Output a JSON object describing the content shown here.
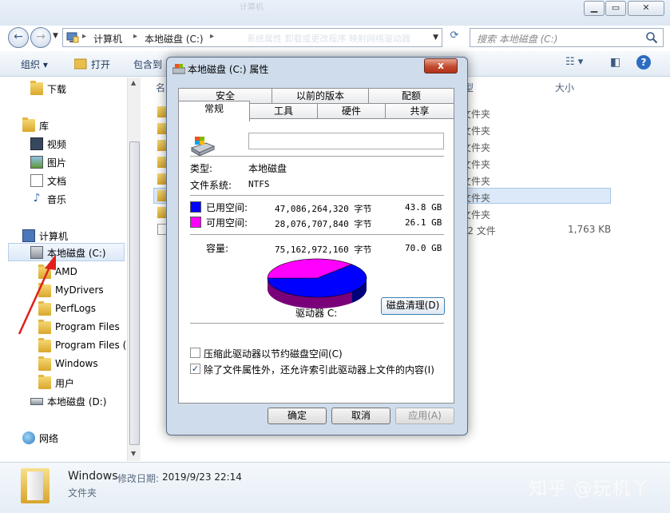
{
  "explorer": {
    "faint_title": "计算机",
    "address": {
      "segments": [
        "计算机",
        "本地磁盘 (C:)"
      ],
      "faint_text": "系统属性    卸载或更改程序    映射网络驱动器"
    },
    "search_placeholder": "搜索 本地磁盘 (C:)",
    "toolbar": {
      "organize": "组织",
      "open": "打开",
      "include": "包含到"
    },
    "nav": {
      "downloads": "下载",
      "library": "库",
      "videos": "视频",
      "pictures": "图片",
      "documents": "文档",
      "music": "音乐",
      "computer": "计算机",
      "drive_c": "本地磁盘 (C:)",
      "folders": [
        "AMD",
        "MyDrivers",
        "PerfLogs",
        "Program Files",
        "Program Files (",
        "Windows",
        "用户"
      ],
      "drive_d": "本地磁盘 (D:)",
      "network": "网络"
    },
    "columns": {
      "name": "名",
      "type": "型",
      "size": "大小"
    },
    "file_types": [
      "文件夹",
      "文件夹",
      "文件夹",
      "文件夹",
      "文件夹",
      "文件夹",
      "文件夹",
      "T2 文件"
    ],
    "last_size": "1,763 KB",
    "details": {
      "name": "Windows",
      "modified_label": "修改日期:",
      "modified": "2019/9/23 22:14",
      "type": "文件夹"
    },
    "watermark": "知乎 @玩机丫"
  },
  "dialog": {
    "title": "本地磁盘 (C:) 属性",
    "close": "x",
    "tabs_back": [
      "安全",
      "以前的版本",
      "配额"
    ],
    "tabs_front": [
      "工具",
      "硬件",
      "共享"
    ],
    "tab_active": "常规",
    "name_value": "",
    "type_label": "类型:",
    "type_value": "本地磁盘",
    "fs_label": "文件系统:",
    "fs_value": "NTFS",
    "used": {
      "label": "已用空间:",
      "bytes": "47,086,264,320 字节",
      "size": "43.8 GB",
      "color": "#0000ff"
    },
    "free": {
      "label": "可用空间:",
      "bytes": "28,076,707,840 字节",
      "size": "26.1 GB",
      "color": "#ff00ff"
    },
    "capacity": {
      "label": "容量:",
      "bytes": "75,162,972,160 字节",
      "size": "70.0 GB"
    },
    "used_fraction": 0.626,
    "drive_label": "驱动器 C:",
    "cleanup": "磁盘清理(D)",
    "compress": {
      "label": "压缩此驱动器以节约磁盘空间(C)",
      "checked": false
    },
    "index": {
      "label": "除了文件属性外，还允许索引此驱动器上文件的内容(I)",
      "checked": true
    },
    "ok": "确定",
    "cancel": "取消",
    "apply": "应用(A)"
  }
}
